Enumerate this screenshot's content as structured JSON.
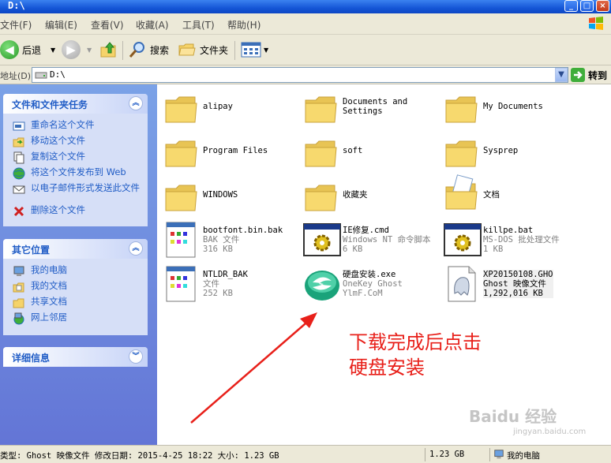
{
  "window": {
    "title": "D:\\"
  },
  "menu": [
    "文件(F)",
    "编辑(E)",
    "查看(V)",
    "收藏(A)",
    "工具(T)",
    "帮助(H)"
  ],
  "toolbar": {
    "back": "后退",
    "search": "搜索",
    "folders": "文件夹"
  },
  "address": {
    "label": "地址(D)",
    "value": "D:\\",
    "go": "转到"
  },
  "left": {
    "tasks_title": "文件和文件夹任务",
    "tasks": [
      "重命名这个文件",
      "移动这个文件",
      "复制这个文件",
      "将这个文件发布到 Web",
      "以电子邮件形式发送此文件",
      "删除这个文件"
    ],
    "places_title": "其它位置",
    "places": [
      "我的电脑",
      "我的文档",
      "共享文档",
      "网上邻居"
    ],
    "details_title": "详细信息"
  },
  "files": [
    {
      "name": "alipay",
      "type": "folder"
    },
    {
      "name": "Documents and",
      "name2": "Settings",
      "type": "folder"
    },
    {
      "name": "My Documents",
      "type": "folder"
    },
    {
      "name": "Program Files",
      "type": "folder"
    },
    {
      "name": "soft",
      "type": "folder"
    },
    {
      "name": "Sysprep",
      "type": "folder"
    },
    {
      "name": "WINDOWS",
      "type": "folder"
    },
    {
      "name": "收藏夹",
      "type": "folder"
    },
    {
      "name": "文档",
      "type": "docfolder"
    },
    {
      "name": "bootfont.bin.bak",
      "l2": "BAK 文件",
      "l3": "316 KB",
      "type": "file"
    },
    {
      "name": "IE修复.cmd",
      "l2": "Windows NT 命令脚本",
      "l3": "6 KB",
      "type": "script"
    },
    {
      "name": "killpe.bat",
      "l2": "MS-DOS 批处理文件",
      "l3": "1 KB",
      "type": "script"
    },
    {
      "name": "NTLDR_BAK",
      "l2": "文件",
      "l3": "252 KB",
      "type": "file"
    },
    {
      "name": "硬盘安装.exe",
      "l2": "OneKey Ghost",
      "l3": "YlmF.CoM",
      "type": "exe"
    },
    {
      "name": "XP20150108.GHO",
      "l2": "Ghost 映像文件",
      "l3": "1,292,016 KB",
      "type": "gho"
    }
  ],
  "annotation": {
    "line1": "下载完成后点击",
    "line2": "硬盘安装"
  },
  "watermark": {
    "main": "Baidu 经验",
    "sub": "jingyan.baidu.com"
  },
  "status": {
    "info": "类型: Ghost 映像文件 修改日期: 2015-4-25 18:22 大小: 1.23 GB",
    "size": "1.23 GB",
    "location": "我的电脑"
  },
  "colors": {
    "link": "#215dc6",
    "annotation": "#e8201a",
    "title_bar": "#1556d6"
  }
}
